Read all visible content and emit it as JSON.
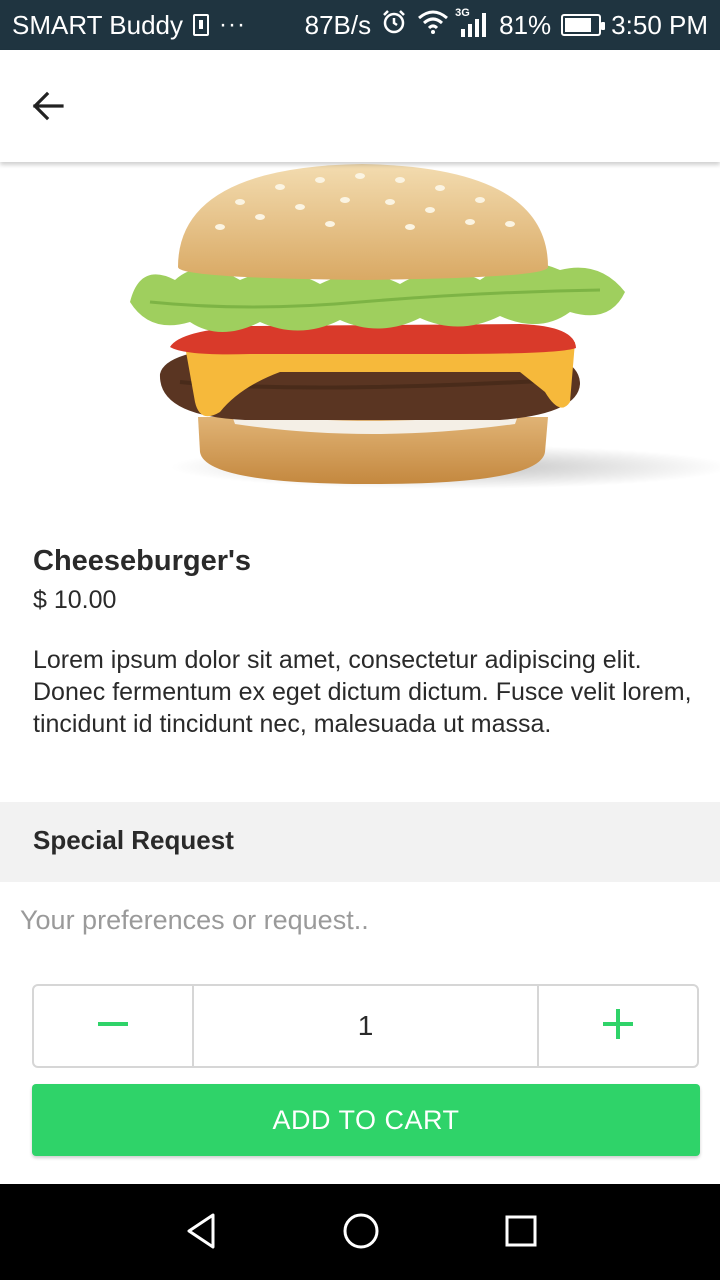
{
  "status_bar": {
    "carrier": "SMART Buddy",
    "more": "···",
    "net_speed": "87B/s",
    "network_type": "3G",
    "battery": "81%",
    "battery_level": 0.81,
    "time": "3:50 PM",
    "icons": [
      "sim-icon",
      "alarm-icon",
      "wifi-icon",
      "signal-icon",
      "battery-icon"
    ]
  },
  "app_bar": {
    "back_icon": "arrow-left-icon"
  },
  "product": {
    "name": "Cheeseburger's",
    "price": "$ 10.00",
    "description": "Lorem ipsum dolor sit amet, consectetur adipiscing elit. Donec fermentum ex eget dictum dictum. Fusce velit lorem, tincidunt id tincidunt nec, malesuada ut massa."
  },
  "special_request": {
    "title": "Special Request",
    "placeholder": "Your preferences or request..",
    "value": ""
  },
  "quantity": {
    "value": "1",
    "minus_icon": "minus-icon",
    "plus_icon": "plus-icon"
  },
  "cart": {
    "label": "ADD TO CART"
  },
  "colors": {
    "accent": "#2fd369",
    "status_bar": "#1f3440",
    "section_bg": "#f2f2f2"
  },
  "nav": {
    "icons": [
      "back-triangle-icon",
      "home-circle-icon",
      "recents-square-icon"
    ]
  }
}
